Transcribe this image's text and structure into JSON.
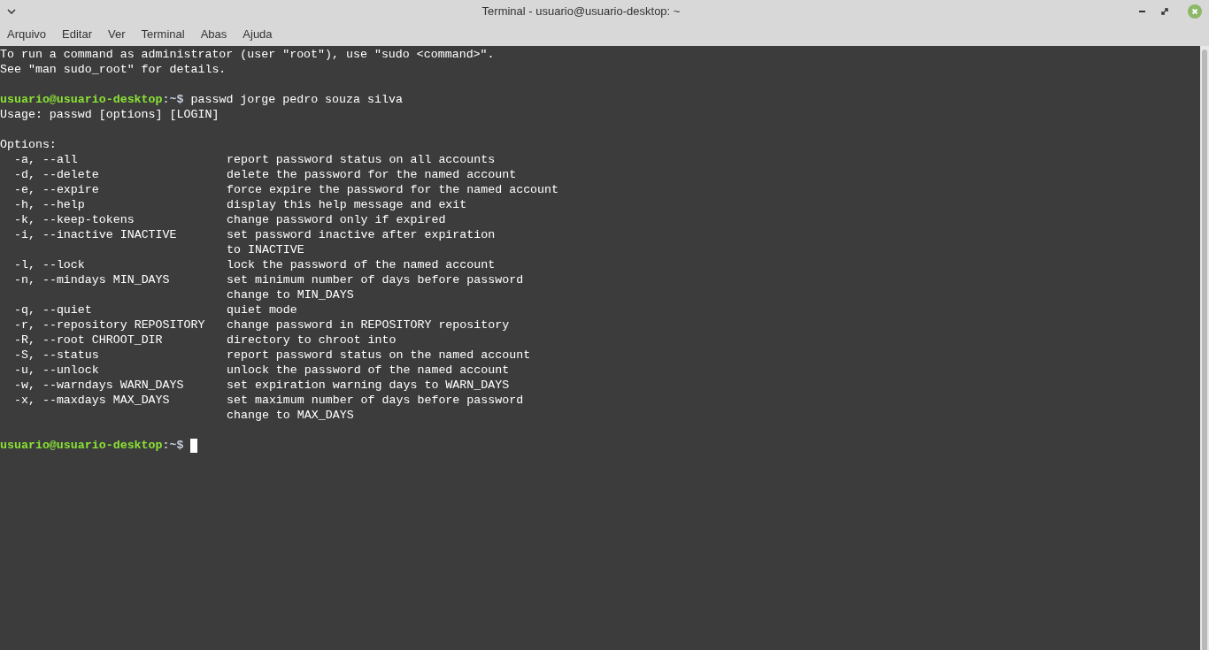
{
  "window": {
    "title": "Terminal - usuario@usuario-desktop: ~"
  },
  "menu": [
    "Arquivo",
    "Editar",
    "Ver",
    "Terminal",
    "Abas",
    "Ajuda"
  ],
  "lines": [
    {
      "kind": "text",
      "text": "To run a command as administrator (user \"root\"), use \"sudo <command>\"."
    },
    {
      "kind": "text",
      "text": "See \"man sudo_root\" for details."
    },
    {
      "kind": "blank"
    },
    {
      "kind": "prompt",
      "host": "usuario@usuario-desktop",
      "path": ":~$",
      "command": "passwd jorge pedro souza silva",
      "cursor": false
    },
    {
      "kind": "text",
      "text": "Usage: passwd [options] [LOGIN]"
    },
    {
      "kind": "blank"
    },
    {
      "kind": "text",
      "text": "Options:"
    },
    {
      "kind": "option",
      "flag": "-a, --all",
      "description": "report password status on all accounts"
    },
    {
      "kind": "option",
      "flag": "-d, --delete",
      "description": "delete the password for the named account"
    },
    {
      "kind": "option",
      "flag": "-e, --expire",
      "description": "force expire the password for the named account"
    },
    {
      "kind": "option",
      "flag": "-h, --help",
      "description": "display this help message and exit"
    },
    {
      "kind": "option",
      "flag": "-k, --keep-tokens",
      "description": "change password only if expired"
    },
    {
      "kind": "option",
      "flag": "-i, --inactive INACTIVE",
      "description": "set password inactive after expiration"
    },
    {
      "kind": "continuation",
      "description": "to INACTIVE"
    },
    {
      "kind": "option",
      "flag": "-l, --lock",
      "description": "lock the password of the named account"
    },
    {
      "kind": "option",
      "flag": "-n, --mindays MIN_DAYS",
      "description": "set minimum number of days before password"
    },
    {
      "kind": "continuation",
      "description": "change to MIN_DAYS"
    },
    {
      "kind": "option",
      "flag": "-q, --quiet",
      "description": "quiet mode"
    },
    {
      "kind": "option",
      "flag": "-r, --repository REPOSITORY",
      "description": "change password in REPOSITORY repository"
    },
    {
      "kind": "option",
      "flag": "-R, --root CHROOT_DIR",
      "description": "directory to chroot into"
    },
    {
      "kind": "option",
      "flag": "-S, --status",
      "description": "report password status on the named account"
    },
    {
      "kind": "option",
      "flag": "-u, --unlock",
      "description": "unlock the password of the named account"
    },
    {
      "kind": "option",
      "flag": "-w, --warndays WARN_DAYS",
      "description": "set expiration warning days to WARN_DAYS"
    },
    {
      "kind": "option",
      "flag": "-x, --maxdays MAX_DAYS",
      "description": "set maximum number of days before password"
    },
    {
      "kind": "continuation",
      "description": "change to MAX_DAYS"
    },
    {
      "kind": "blank"
    },
    {
      "kind": "prompt",
      "host": "usuario@usuario-desktop",
      "path": ":~$",
      "cursor": true
    }
  ]
}
